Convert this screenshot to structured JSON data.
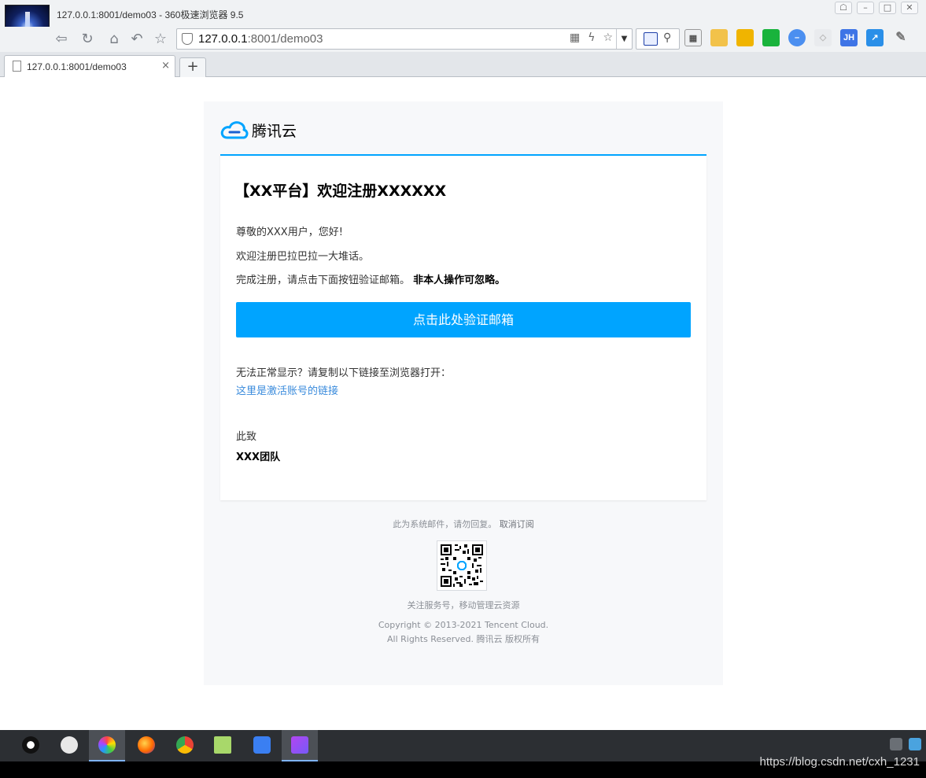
{
  "window": {
    "title": "127.0.0.1:8001/demo03 - 360极速浏览器 9.5"
  },
  "toolbar": {
    "address_host": "127.0.0.1",
    "address_rest": ":8001/demo03"
  },
  "tab": {
    "label": "127.0.0.1:8001/demo03",
    "close": "×",
    "new_tab": "+"
  },
  "email": {
    "brand": "腾讯云",
    "title": "【XX平台】欢迎注册XXXXXX",
    "greeting_prefix": "尊敬的XXX用户",
    "greeting_suffix": "，您好!",
    "welcome": "欢迎注册巴拉巴拉一大堆话。",
    "instruction": "完成注册，请点击下面按钮验证邮箱。",
    "instruction_bold": "非本人操作可忽略。",
    "verify_button": "点击此处验证邮箱",
    "fallback": "无法正常显示？请复制以下链接至浏览器打开：",
    "link_text": "这里是激活账号的链接",
    "closing": "此致",
    "team": "XXX团队"
  },
  "footer": {
    "system_notice": "此为系统邮件，请勿回复。",
    "unsubscribe": "取消订阅",
    "follow": "关注服务号，移动管理云资源",
    "copyright_1": "Copyright © 2013-2021 Tencent Cloud.",
    "copyright_2": "All Rights Reserved. 腾讯云 版权所有"
  },
  "watermark": "https://blog.csdn.net/cxh_1231",
  "colors": {
    "accent": "#00a4ff",
    "link": "#3a8bdc",
    "page_bg": "#f7f8fa"
  }
}
